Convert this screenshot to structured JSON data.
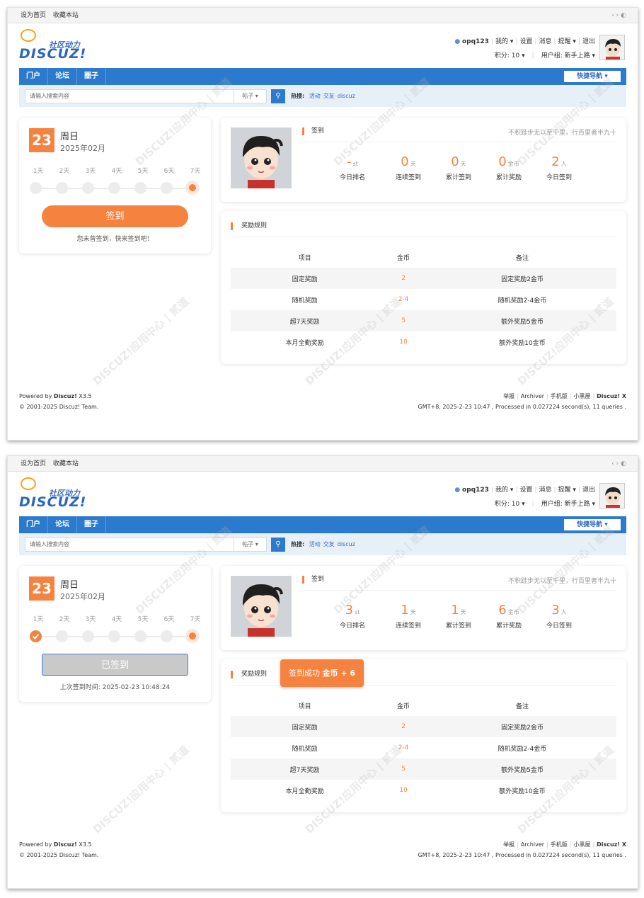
{
  "topbar": {
    "set_home": "设为首页",
    "favorite": "收藏本站",
    "arrows": "‹ ›",
    "palette_icon": "palette-icon"
  },
  "logo": {
    "cn": "社区动力",
    "en": "DISCUZ!"
  },
  "user": {
    "name": "opq123",
    "my": "我的",
    "settings": "设置",
    "messages": "消息",
    "notify": "提醒",
    "logout": "退出",
    "points": "积分: 10",
    "group": "用户组: 新手上路"
  },
  "nav": {
    "items": [
      "门户",
      "论坛",
      "圈子"
    ],
    "quick": "快捷导航"
  },
  "search": {
    "placeholder": "请输入搜索内容",
    "type": "帖子",
    "hot_label": "热搜:",
    "hot": [
      "活动",
      "交友",
      "discuz"
    ]
  },
  "calendar": {
    "date": "23",
    "weekday": "周日",
    "year_month": "2025年02月",
    "days": [
      "1天",
      "2天",
      "3天",
      "4天",
      "5天",
      "6天",
      "7天"
    ]
  },
  "states": [
    {
      "sign_button": "签到",
      "hint": "您未曾签到，快来签到吧！",
      "signed_days": 0,
      "stats": [
        {
          "num": "-",
          "unit": "st",
          "label": "今日排名"
        },
        {
          "num": "0",
          "unit": "天",
          "label": "连续签到"
        },
        {
          "num": "0",
          "unit": "天",
          "label": "累计签到"
        },
        {
          "num": "0",
          "unit": "金币",
          "label": "累计奖励"
        },
        {
          "num": "2",
          "unit": "人",
          "label": "今日签到"
        }
      ]
    },
    {
      "sign_button": "已签到",
      "hint": "上次签到时间:   2025-02-23 10:48:24",
      "signed_days": 1,
      "toast_text": "签到成功",
      "toast_reward": "金币 + 6",
      "stats": [
        {
          "num": "3",
          "unit": "st",
          "label": "今日排名"
        },
        {
          "num": "1",
          "unit": "天",
          "label": "连续签到"
        },
        {
          "num": "1",
          "unit": "天",
          "label": "累计签到"
        },
        {
          "num": "6",
          "unit": "金币",
          "label": "累计奖励"
        },
        {
          "num": "3",
          "unit": "人",
          "label": "今日签到"
        }
      ]
    }
  ],
  "sign_panel": {
    "title": "签到",
    "motto": "不积跬步无以至千里，行百里者半九十"
  },
  "rules": {
    "title": "奖励规则",
    "headers": [
      "项目",
      "金币",
      "备注"
    ],
    "rows": [
      [
        "固定奖励",
        "2",
        "固定奖励2金币"
      ],
      [
        "随机奖励",
        "2-4",
        "随机奖励2-4金币"
      ],
      [
        "超7天奖励",
        "5",
        "额外奖励5金币"
      ],
      [
        "本月全勤奖励",
        "10",
        "额外奖励10金币"
      ]
    ]
  },
  "footer": {
    "powered": "Powered by",
    "brand": "Discuz!",
    "version": "X3.5",
    "copyright": "© 2001-2025 Discuz! Team.",
    "links": [
      "举报",
      "Archiver",
      "手机版",
      "小黑屋"
    ],
    "brand_x": "Discuz! X",
    "processed": "GMT+8, 2025-2-23 10:47 , Processed in 0.027224 second(s), 11 queries ."
  },
  "watermark": "DISCUZ!应用中心 | 贰道"
}
